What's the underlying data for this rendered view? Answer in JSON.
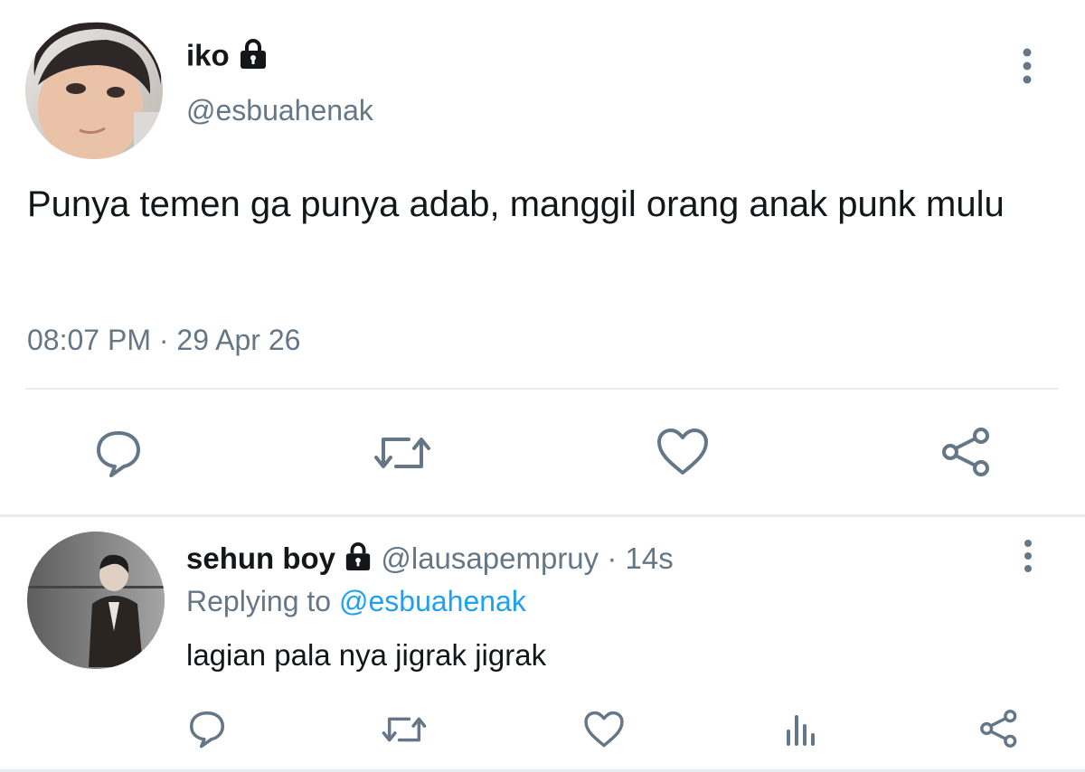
{
  "main_tweet": {
    "display_name": "iko",
    "handle": "@esbuahenak",
    "text": "Punya temen ga punya adab, manggil orang anak punk mulu",
    "timestamp": "08:07 PM · 29 Apr 26",
    "icons": [
      "lock-icon",
      "more-vertical-icon",
      "reply-icon",
      "retweet-icon",
      "like-icon",
      "share-icon"
    ]
  },
  "reply_tweet": {
    "display_name": "sehun boy",
    "handle": "@lausapempruy",
    "separator": "·",
    "time_ago": "14s",
    "replying_prefix": "Replying to",
    "replying_to": "@esbuahenak",
    "text": "lagian pala nya jigrak jigrak",
    "icons": [
      "lock-icon",
      "more-vertical-icon",
      "reply-icon",
      "retweet-icon",
      "like-icon",
      "analytics-icon",
      "share-icon"
    ]
  },
  "colors": {
    "text_primary": "#14171a",
    "text_secondary": "#657786",
    "link": "#1da1f2",
    "divider": "#e6ecf0"
  }
}
